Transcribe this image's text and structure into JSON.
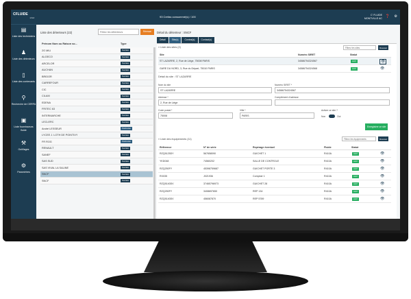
{
  "app": {
    "name": "CFLUIDE",
    "version": "1.6.2"
  },
  "topbar": {
    "credits": "93 Cerfas consommé(s) / 100",
    "user_name": "C' FLUIDE",
    "user_company": "MONTVILLE AC",
    "help_icon": "question-circle-icon",
    "settings_icon": "gear-icon"
  },
  "sidebar": {
    "items": [
      {
        "label": "Liste des techniciens",
        "icon": "clipboard-icon"
      },
      {
        "label": "Liste des détenteurs",
        "icon": "user-icon"
      },
      {
        "label": "Liste des contenants",
        "icon": "cylinder-icon"
      },
      {
        "label": "Recherche de CERFA",
        "icon": "search-icon"
      },
      {
        "label": "Liste fournisseurs fluide",
        "icon": "truck-icon"
      },
      {
        "label": "Outillages",
        "icon": "wrench-icon"
      },
      {
        "label": "Paramètres",
        "icon": "gear-icon"
      }
    ]
  },
  "holders": {
    "title": "Liste des détenteurs (22)",
    "filter_placeholder": "Filtrez les détenteurs",
    "filter_button": "Réessai",
    "col_name": "Prénom Nom ou Raison so...",
    "col_type": "Type",
    "rows": [
      {
        "name": "2G MIU",
        "type": "Société"
      },
      {
        "name": "ALGECO",
        "type": "Société"
      },
      {
        "name": "ARCELOR",
        "type": "Société"
      },
      {
        "name": "AUCHAN",
        "type": "Société"
      },
      {
        "name": "BRIDOR",
        "type": "Société"
      },
      {
        "name": "CARREFOUR",
        "type": "Société"
      },
      {
        "name": "CIC",
        "type": "Société"
      },
      {
        "name": "CILAM",
        "type": "Société"
      },
      {
        "name": "EDENA",
        "type": "Société"
      },
      {
        "name": "FRITEC 63",
        "type": "Société"
      },
      {
        "name": "INTERMARCHE",
        "type": "Société"
      },
      {
        "name": "LECLERC",
        "type": "Société"
      },
      {
        "name": "André LESSEUR",
        "type": "Particulier"
      },
      {
        "name": "LYCEE J. LOTH DE POINTIVY",
        "type": "Société"
      },
      {
        "name": "FR ROG",
        "type": "Particulier"
      },
      {
        "name": "RENAULT",
        "type": "Société"
      },
      {
        "name": "SANEF",
        "type": "Société"
      },
      {
        "name": "SAS SUD",
        "type": "Société"
      },
      {
        "name": "SAS VIVAL LA SALINE",
        "type": "Société"
      },
      {
        "name": "SNCF",
        "type": "Société"
      },
      {
        "name": "SNCF",
        "type": "Société"
      }
    ]
  },
  "detail": {
    "title": "Détail du détenteur : SNCF",
    "tabs": [
      "Détail",
      "Site(s)",
      "Contrat(s)",
      "Contact(s)"
    ],
    "sites": {
      "title": "« Liste des sites (2)",
      "filter_placeholder": "Filtrez les sites",
      "filter_button": "Réessai",
      "headers": [
        "Site",
        "Numéro SIRET",
        "Statut"
      ],
      "rows": [
        {
          "site": "ST LAZARRE, 2, Rue de Liège, 75008 PARIS",
          "siret": "34586754324567",
          "status": "Actif"
        },
        {
          "site": "GARE DU NORD, 3, Rue du Départ, 75010 PARIS",
          "siret": "34586754324568",
          "status": "Actif"
        }
      ]
    },
    "site_form": {
      "title": "Détail du site : ST LAZARRE",
      "name_label": "Nom du site",
      "name_value": "ST LAZARRE",
      "siret_label": "Numéro SIRET *",
      "siret_value": "34586754324567",
      "address_label": "Adresse *",
      "address_value": "2, Rue de Liège",
      "complement_label": "Complément d'adresse",
      "complement_value": "",
      "zip_label": "Code postal *",
      "zip_value": "75008",
      "city_label": "Ville *",
      "city_value": "PARIS",
      "active_label": "Activer ce site ?",
      "no": "Non",
      "yes": "Oui",
      "save_button": "Enregistrer ce site"
    },
    "equipment": {
      "title": "« Liste des équipements (11)",
      "filter_placeholder": "Filtrez les équipements",
      "filter_button": "Réessai",
      "headers": [
        "Référence",
        "N° de série",
        "Repérage éventuel",
        "Fluide",
        "Statut"
      ],
      "rows": [
        {
          "ref": "RZQ5125DY",
          "serial": "567658090",
          "loc": "GUICHET 1",
          "fluid": "R410A",
          "status": "Actif"
        },
        {
          "ref": "YKD048",
          "serial": "74560202",
          "loc": "SALLE DE CONTROLE",
          "fluid": "R410A",
          "status": "Actif"
        },
        {
          "ref": "RZQ250FY",
          "serial": "45398759687",
          "loc": "GUICHET PORTE 3",
          "fluid": "R410A",
          "status": "Actif"
        },
        {
          "ref": "RX035",
          "serial": "J021936",
          "loc": "Comptoir 1",
          "fluid": "R410A",
          "status": "Actif"
        },
        {
          "ref": "RZQ5140DV",
          "serial": "37465796973",
          "loc": "GUICHET 28",
          "fluid": "R410A",
          "status": "Actif"
        },
        {
          "ref": "RZQ250FY",
          "serial": "3408697650",
          "loc": "REP 134",
          "fluid": "R410A",
          "status": "Actif"
        },
        {
          "ref": "RZQ5140DV",
          "serial": "456087870",
          "loc": "REP 5789",
          "fluid": "R410A",
          "status": "Actif"
        }
      ]
    }
  }
}
